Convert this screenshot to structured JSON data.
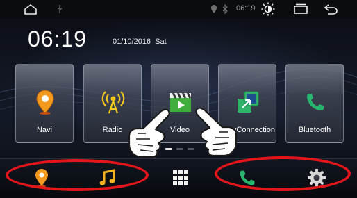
{
  "status_bar": {
    "home_icon": "home-outline-icon",
    "usb_icon": "usb-icon",
    "location_icon": "location-pin-icon",
    "bluetooth_icon": "bluetooth-icon",
    "time": "06:19",
    "brightness_icon": "brightness-icon",
    "recent_apps_icon": "recent-apps-icon",
    "back_icon": "back-arrow-icon"
  },
  "clock": {
    "time": "06:19",
    "date": "01/10/2016  Sat"
  },
  "apps": [
    {
      "label": "Navi",
      "icon": "navigation-pin-icon"
    },
    {
      "label": "Radio",
      "icon": "radio-antenna-icon"
    },
    {
      "label": "Video",
      "icon": "video-clapper-icon"
    },
    {
      "label": "EasyConnection",
      "icon": "screen-mirror-icon"
    },
    {
      "label": "Bluetooth",
      "icon": "phone-icon"
    }
  ],
  "pager": {
    "pages": 3,
    "current": 1
  },
  "dock": [
    {
      "icon": "navigation-pin-icon",
      "highlighted": true
    },
    {
      "icon": "music-note-icon",
      "highlighted": true
    },
    {
      "icon": "app-grid-icon",
      "highlighted": false
    },
    {
      "icon": "phone-icon",
      "highlighted": true
    },
    {
      "icon": "settings-gear-icon",
      "highlighted": true
    }
  ],
  "colors": {
    "highlight_ellipse": "#e4151b",
    "navi_orange": "#f39a1e",
    "radio_yellow": "#f3c81e",
    "video_green": "#3fae3a",
    "easyconnect_green": "#2fb36a",
    "bluetooth_green": "#27b56e"
  }
}
